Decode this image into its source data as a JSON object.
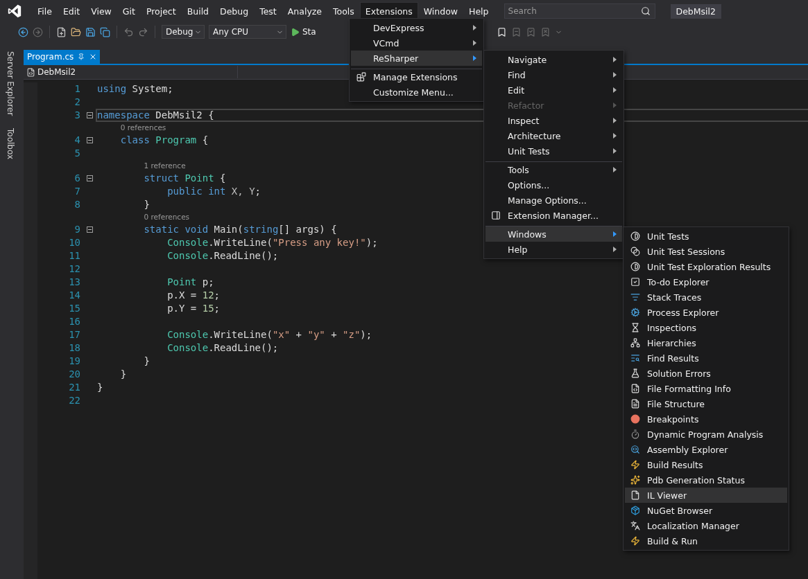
{
  "menubar": {
    "items": [
      {
        "label": "File",
        "selected": false
      },
      {
        "label": "Edit",
        "selected": false
      },
      {
        "label": "View",
        "selected": false
      },
      {
        "label": "Git",
        "selected": false
      },
      {
        "label": "Project",
        "selected": false
      },
      {
        "label": "Build",
        "selected": false
      },
      {
        "label": "Debug",
        "selected": false
      },
      {
        "label": "Test",
        "selected": false
      },
      {
        "label": "Analyze",
        "selected": false
      },
      {
        "label": "Tools",
        "selected": false
      },
      {
        "label": "Extensions",
        "selected": true
      },
      {
        "label": "Window",
        "selected": false
      },
      {
        "label": "Help",
        "selected": false
      }
    ],
    "search": {
      "placeholder": "Search"
    },
    "solution_title": "DebMsil2"
  },
  "toolbar": {
    "configuration": "Debug",
    "platform": "Any CPU",
    "start": "Sta"
  },
  "side_tabs": [
    "Server Explorer",
    "Toolbox"
  ],
  "tabs": [
    {
      "label": "Program.cs",
      "selected": true
    }
  ],
  "navigation": {
    "scope": "DebMsil2"
  },
  "editor": {
    "lines": [
      {
        "number": "1",
        "tokens": [
          {
            "kind": "keyword",
            "text": "using"
          },
          {
            "kind": "plain",
            "text": " System;"
          }
        ]
      },
      {
        "number": "2"
      },
      {
        "number": "3",
        "fold": true,
        "current": true,
        "tokens": [
          {
            "kind": "keyword",
            "text": "namespace"
          },
          {
            "kind": "plain",
            "text": " DebMsil2 {"
          }
        ]
      },
      {
        "number": "4",
        "fold": true,
        "lens": "0 references",
        "tokens": [
          {
            "kind": "keyword",
            "text": "    class "
          },
          {
            "kind": "type",
            "text": "Program"
          },
          {
            "kind": "plain",
            "text": " {"
          }
        ]
      },
      {
        "number": "5"
      },
      {
        "number": "6",
        "fold": true,
        "lens": "1 reference",
        "tokens": [
          {
            "kind": "keyword",
            "text": "        struct "
          },
          {
            "kind": "type",
            "text": "Point"
          },
          {
            "kind": "plain",
            "text": " {"
          }
        ]
      },
      {
        "number": "7",
        "tokens": [
          {
            "kind": "keyword",
            "text": "            public int"
          },
          {
            "kind": "ident",
            "text": " X, Y"
          },
          {
            "kind": "plain",
            "text": ";"
          }
        ]
      },
      {
        "number": "8",
        "tokens": [
          {
            "kind": "plain",
            "text": "        }"
          }
        ]
      },
      {
        "number": "9",
        "fold": true,
        "lens": "0 references",
        "tokens": [
          {
            "kind": "keyword",
            "text": "        static void"
          },
          {
            "kind": "plain",
            "text": " Main("
          },
          {
            "kind": "keyword",
            "text": "string"
          },
          {
            "kind": "plain",
            "text": "[] args) {"
          }
        ]
      },
      {
        "number": "10",
        "tokens": [
          {
            "kind": "type",
            "text": "            Console"
          },
          {
            "kind": "plain",
            "text": ".WriteLine("
          },
          {
            "kind": "string",
            "text": "\"Press any key!\""
          },
          {
            "kind": "plain",
            "text": ");"
          }
        ]
      },
      {
        "number": "11",
        "tokens": [
          {
            "kind": "type",
            "text": "            Console"
          },
          {
            "kind": "plain",
            "text": ".ReadLine();"
          }
        ]
      },
      {
        "number": "12"
      },
      {
        "number": "13",
        "tokens": [
          {
            "kind": "type",
            "text": "            Point"
          },
          {
            "kind": "plain",
            "text": " p;"
          }
        ]
      },
      {
        "number": "14",
        "tokens": [
          {
            "kind": "plain",
            "text": "            p.X = "
          },
          {
            "kind": "number",
            "text": "12"
          },
          {
            "kind": "plain",
            "text": ";"
          }
        ]
      },
      {
        "number": "15",
        "tokens": [
          {
            "kind": "plain",
            "text": "            p.Y = "
          },
          {
            "kind": "number",
            "text": "15"
          },
          {
            "kind": "plain",
            "text": ";"
          }
        ]
      },
      {
        "number": "16"
      },
      {
        "number": "17",
        "tokens": [
          {
            "kind": "type",
            "text": "            Console"
          },
          {
            "kind": "plain",
            "text": ".WriteLine("
          },
          {
            "kind": "string",
            "text": "\"x\""
          },
          {
            "kind": "plain",
            "text": " + "
          },
          {
            "kind": "string",
            "text": "\"y\""
          },
          {
            "kind": "plain",
            "text": " + "
          },
          {
            "kind": "string",
            "text": "\"z\""
          },
          {
            "kind": "plain",
            "text": ");"
          }
        ]
      },
      {
        "number": "18",
        "tokens": [
          {
            "kind": "type",
            "text": "            Console"
          },
          {
            "kind": "plain",
            "text": ".ReadLine();"
          }
        ]
      },
      {
        "number": "19",
        "tokens": [
          {
            "kind": "plain",
            "text": "        }"
          }
        ]
      },
      {
        "number": "20",
        "tokens": [
          {
            "kind": "plain",
            "text": "    }"
          }
        ]
      },
      {
        "number": "21",
        "tokens": [
          {
            "kind": "plain",
            "text": "}"
          }
        ]
      },
      {
        "number": "22"
      }
    ]
  },
  "extensions_menu": {
    "items": [
      {
        "label": "DevExpress",
        "submenu": true,
        "selected": false
      },
      {
        "label": "VCmd",
        "submenu": true,
        "selected": false
      },
      {
        "label": "ReSharper",
        "submenu": true,
        "selected": true
      },
      {
        "label": "Manage Extensions",
        "submenu": false,
        "selected": false,
        "separator_before": true
      },
      {
        "label": "Customize Menu...",
        "submenu": false,
        "selected": false
      }
    ]
  },
  "resharper_menu": {
    "items": [
      {
        "label": "Navigate",
        "submenu": true,
        "selected": false,
        "disabled": false
      },
      {
        "label": "Find",
        "submenu": true,
        "selected": false,
        "disabled": false
      },
      {
        "label": "Edit",
        "submenu": true,
        "selected": false,
        "disabled": false
      },
      {
        "label": "Refactor",
        "submenu": true,
        "selected": false,
        "disabled": true
      },
      {
        "label": "Inspect",
        "submenu": true,
        "selected": false,
        "disabled": false
      },
      {
        "label": "Architecture",
        "submenu": true,
        "selected": false,
        "disabled": false
      },
      {
        "label": "Unit Tests",
        "submenu": true,
        "selected": false,
        "disabled": false
      },
      {
        "label": "Tools",
        "submenu": true,
        "selected": false,
        "disabled": false,
        "separator_before": true
      },
      {
        "label": "Options...",
        "submenu": false,
        "selected": false,
        "disabled": false
      },
      {
        "label": "Manage Options...",
        "submenu": false,
        "selected": false,
        "disabled": false
      },
      {
        "label": "Extension Manager...",
        "submenu": false,
        "selected": false,
        "disabled": false
      },
      {
        "label": "Windows",
        "submenu": true,
        "selected": true,
        "disabled": false,
        "separator_before": true
      },
      {
        "label": "Help",
        "submenu": true,
        "selected": false,
        "disabled": false
      }
    ]
  },
  "windows_menu": {
    "items": [
      {
        "label": "Unit Tests",
        "selected": false
      },
      {
        "label": "Unit Test Sessions",
        "selected": false
      },
      {
        "label": "Unit Test Exploration Results",
        "selected": false
      },
      {
        "label": "To-do Explorer",
        "selected": false
      },
      {
        "label": "Stack Traces",
        "selected": false
      },
      {
        "label": "Process Explorer",
        "selected": false
      },
      {
        "label": "Inspections",
        "selected": false
      },
      {
        "label": "Hierarchies",
        "selected": false
      },
      {
        "label": "Find Results",
        "selected": false
      },
      {
        "label": "Solution Errors",
        "selected": false
      },
      {
        "label": "File Formatting Info",
        "selected": false
      },
      {
        "label": "File Structure",
        "selected": false
      },
      {
        "label": "Breakpoints",
        "selected": false
      },
      {
        "label": "Dynamic Program Analysis",
        "selected": false
      },
      {
        "label": "Assembly Explorer",
        "selected": false
      },
      {
        "label": "Build Results",
        "selected": false
      },
      {
        "label": "Pdb Generation Status",
        "selected": false
      },
      {
        "label": "IL Viewer",
        "selected": true
      },
      {
        "label": "NuGet Browser",
        "selected": false
      },
      {
        "label": "Localization Manager",
        "selected": false
      },
      {
        "label": "Build & Run",
        "selected": false
      }
    ]
  }
}
